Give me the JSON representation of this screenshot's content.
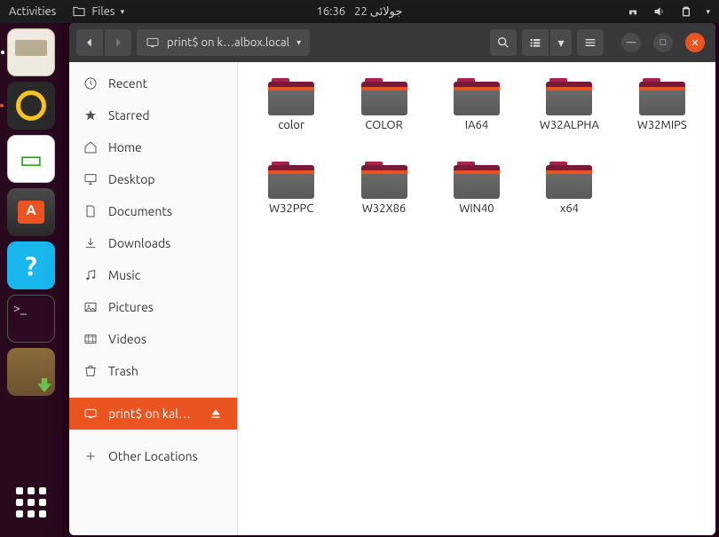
{
  "top_panel": {
    "activities": "Activities",
    "app_name": "Files",
    "time": "16:36",
    "date": "جولائی 22"
  },
  "dock": {
    "tooltip": "Rhythmbox"
  },
  "window": {
    "path_label": "print$ on k…albox.local"
  },
  "sidebar": {
    "recent": "Recent",
    "starred": "Starred",
    "home": "Home",
    "desktop": "Desktop",
    "documents": "Documents",
    "downloads": "Downloads",
    "music": "Music",
    "pictures": "Pictures",
    "videos": "Videos",
    "trash": "Trash",
    "mount": "print$ on kal…",
    "other": "Other Locations"
  },
  "folders": [
    "color",
    "COLOR",
    "IA64",
    "W32ALPHA",
    "W32MIPS",
    "W32PPC",
    "W32X86",
    "WIN40",
    "x64"
  ]
}
